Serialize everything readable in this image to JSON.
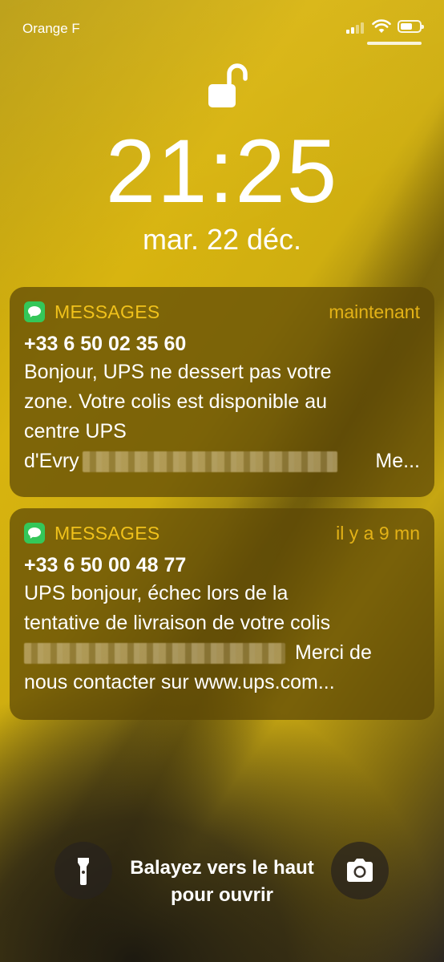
{
  "status_bar": {
    "carrier": "Orange F",
    "signal_bars": 4,
    "signal_bars_active": 2,
    "battery_level": 0.6,
    "wifi_icon": "wifi-icon",
    "battery_icon": "battery-icon"
  },
  "lock": {
    "icon": "unlocked-padlock-icon"
  },
  "clock": {
    "time": "21:25",
    "date": "mar. 22 déc."
  },
  "notifications": [
    {
      "app": "MESSAGES",
      "time": "maintenant",
      "sender": "+33 6 50 02 35 60",
      "body_lines": [
        "Bonjour, UPS ne dessert pas votre",
        "zone. Votre colis est disponible au",
        "centre UPS"
      ],
      "last_line_start": "d'Evry",
      "last_line_end": "Me..."
    },
    {
      "app": "MESSAGES",
      "time": "il y a 9 mn",
      "sender": "+33 6 50 00 48 77",
      "body_lines": [
        "UPS bonjour, échec lors de la",
        "tentative de livraison de votre colis"
      ],
      "blurred_line_end": "Merci de",
      "last_line": "nous contacter sur www.ups.com..."
    }
  ],
  "bottom": {
    "flashlight_icon": "flashlight-icon",
    "camera_icon": "camera-icon",
    "swipe_hint": "Balayez vers le haut pour ouvrir"
  },
  "colors": {
    "app_name": "#f1c21b",
    "message_icon": "#34c759",
    "notification_bg": "#5c4606"
  }
}
